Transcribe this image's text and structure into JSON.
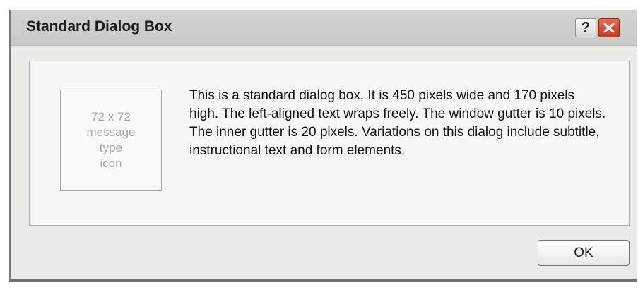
{
  "window": {
    "title": "Standard Dialog Box",
    "help_label": "?"
  },
  "icon_placeholder": {
    "lines": [
      "72 x 72",
      "message",
      "type",
      "icon"
    ]
  },
  "message": "This is a standard dialog box. It is 450 pixels wide and 170 pixels high. The left-aligned text wraps freely. The window gutter is 10 pixels. The inner gutter is 20 pixels. Variations on this dialog include subtitle, instructional text and form elements.",
  "buttons": {
    "ok_label": "OK"
  },
  "icons": {
    "help": "question-mark-icon",
    "close": "close-x-icon"
  },
  "colors": {
    "close_button": "#d9472b",
    "panel_border": "#9fb2bc",
    "window_background": "#e9ebe6"
  }
}
